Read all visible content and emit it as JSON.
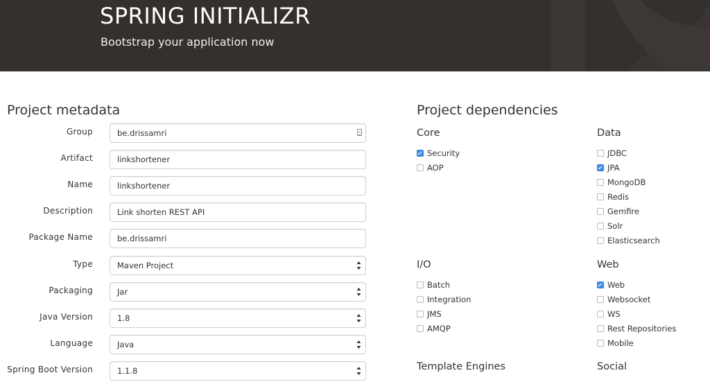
{
  "header": {
    "title": "SPRING INITIALIZR",
    "subtitle": "Bootstrap your application now"
  },
  "metadata": {
    "title": "Project metadata",
    "fields": [
      {
        "label": "Group",
        "value": "be.drissamri",
        "kind": "text"
      },
      {
        "label": "Artifact",
        "value": "linkshortener",
        "kind": "text"
      },
      {
        "label": "Name",
        "value": "linkshortener",
        "kind": "text"
      },
      {
        "label": "Description",
        "value": "Link shorten REST API",
        "kind": "text"
      },
      {
        "label": "Package Name",
        "value": "be.drissamri",
        "kind": "text"
      },
      {
        "label": "Type",
        "value": "Maven Project",
        "kind": "select"
      },
      {
        "label": "Packaging",
        "value": "Jar",
        "kind": "select"
      },
      {
        "label": "Java Version",
        "value": "1.8",
        "kind": "select"
      },
      {
        "label": "Language",
        "value": "Java",
        "kind": "select"
      },
      {
        "label": "Spring Boot Version",
        "value": "1.1.8",
        "kind": "select"
      }
    ]
  },
  "dependencies": {
    "title": "Project dependencies",
    "groups": [
      {
        "name": "Core",
        "items": [
          {
            "label": "Security",
            "checked": true
          },
          {
            "label": "AOP",
            "checked": false
          }
        ]
      },
      {
        "name": "Data",
        "items": [
          {
            "label": "JDBC",
            "checked": false
          },
          {
            "label": "JPA",
            "checked": true
          },
          {
            "label": "MongoDB",
            "checked": false
          },
          {
            "label": "Redis",
            "checked": false
          },
          {
            "label": "Gemfire",
            "checked": false
          },
          {
            "label": "Solr",
            "checked": false
          },
          {
            "label": "Elasticsearch",
            "checked": false
          }
        ]
      },
      {
        "name": "I/O",
        "items": [
          {
            "label": "Batch",
            "checked": false
          },
          {
            "label": "Integration",
            "checked": false
          },
          {
            "label": "JMS",
            "checked": false
          },
          {
            "label": "AMQP",
            "checked": false
          }
        ]
      },
      {
        "name": "Web",
        "items": [
          {
            "label": "Web",
            "checked": true
          },
          {
            "label": "Websocket",
            "checked": false
          },
          {
            "label": "WS",
            "checked": false
          },
          {
            "label": "Rest Repositories",
            "checked": false
          },
          {
            "label": "Mobile",
            "checked": false
          }
        ]
      },
      {
        "name": "Template Engines",
        "items": []
      },
      {
        "name": "Social",
        "items": []
      }
    ]
  },
  "colors": {
    "header_bg": "#34302d",
    "checkbox_checked": "#3b8ee8"
  }
}
